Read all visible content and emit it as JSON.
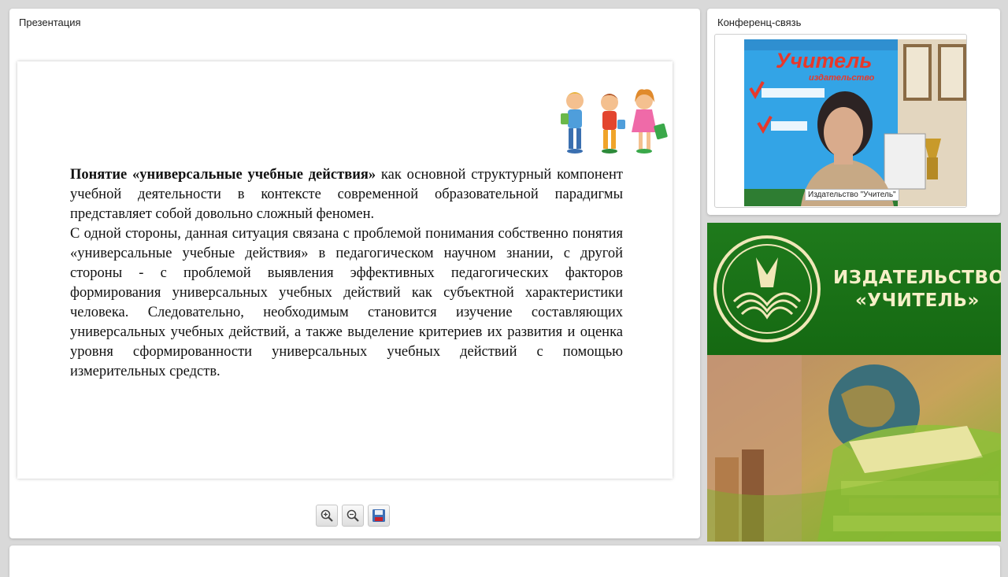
{
  "presentation": {
    "title": "Презентация",
    "slide": {
      "intro_bold": "Понятие «универсальные учебные действия»",
      "intro_rest": " как основной структурный компонент учебной деятельности в контексте современной образовательной парадигмы представляет собой довольно сложный феномен.",
      "paragraph2": "С одной стороны, данная ситуация связана с проблемой понимания собственно понятия «универсальные учебные действия» в педагогическом научном знании, с другой стороны - с проблемой выявления эффективных педагогических факторов формирования универсальных учебных действий как субъектной характеристики человека. Следовательно, необходимым становится изучение составляющих универсальных учебных действий, а также выделение критериев их развития и оценка уровня сформированности универсальных учебных действий с помощью измерительных средств."
    },
    "toolbar": {
      "zoom_in_icon": "zoom-in-icon",
      "zoom_out_icon": "zoom-out-icon",
      "save_icon": "save-icon"
    }
  },
  "conference": {
    "title": "Конференц-связь",
    "video_caption": "Издательство \"Учитель\"",
    "backdrop_brand": "Учитель",
    "backdrop_sub": "издательство"
  },
  "banner": {
    "line1": "ИЗДАТЕЛЬСТВО",
    "line2": "«УЧИТЕЛЬ»",
    "colors": {
      "green": "#1b7418",
      "cream": "#f5efc7"
    }
  }
}
